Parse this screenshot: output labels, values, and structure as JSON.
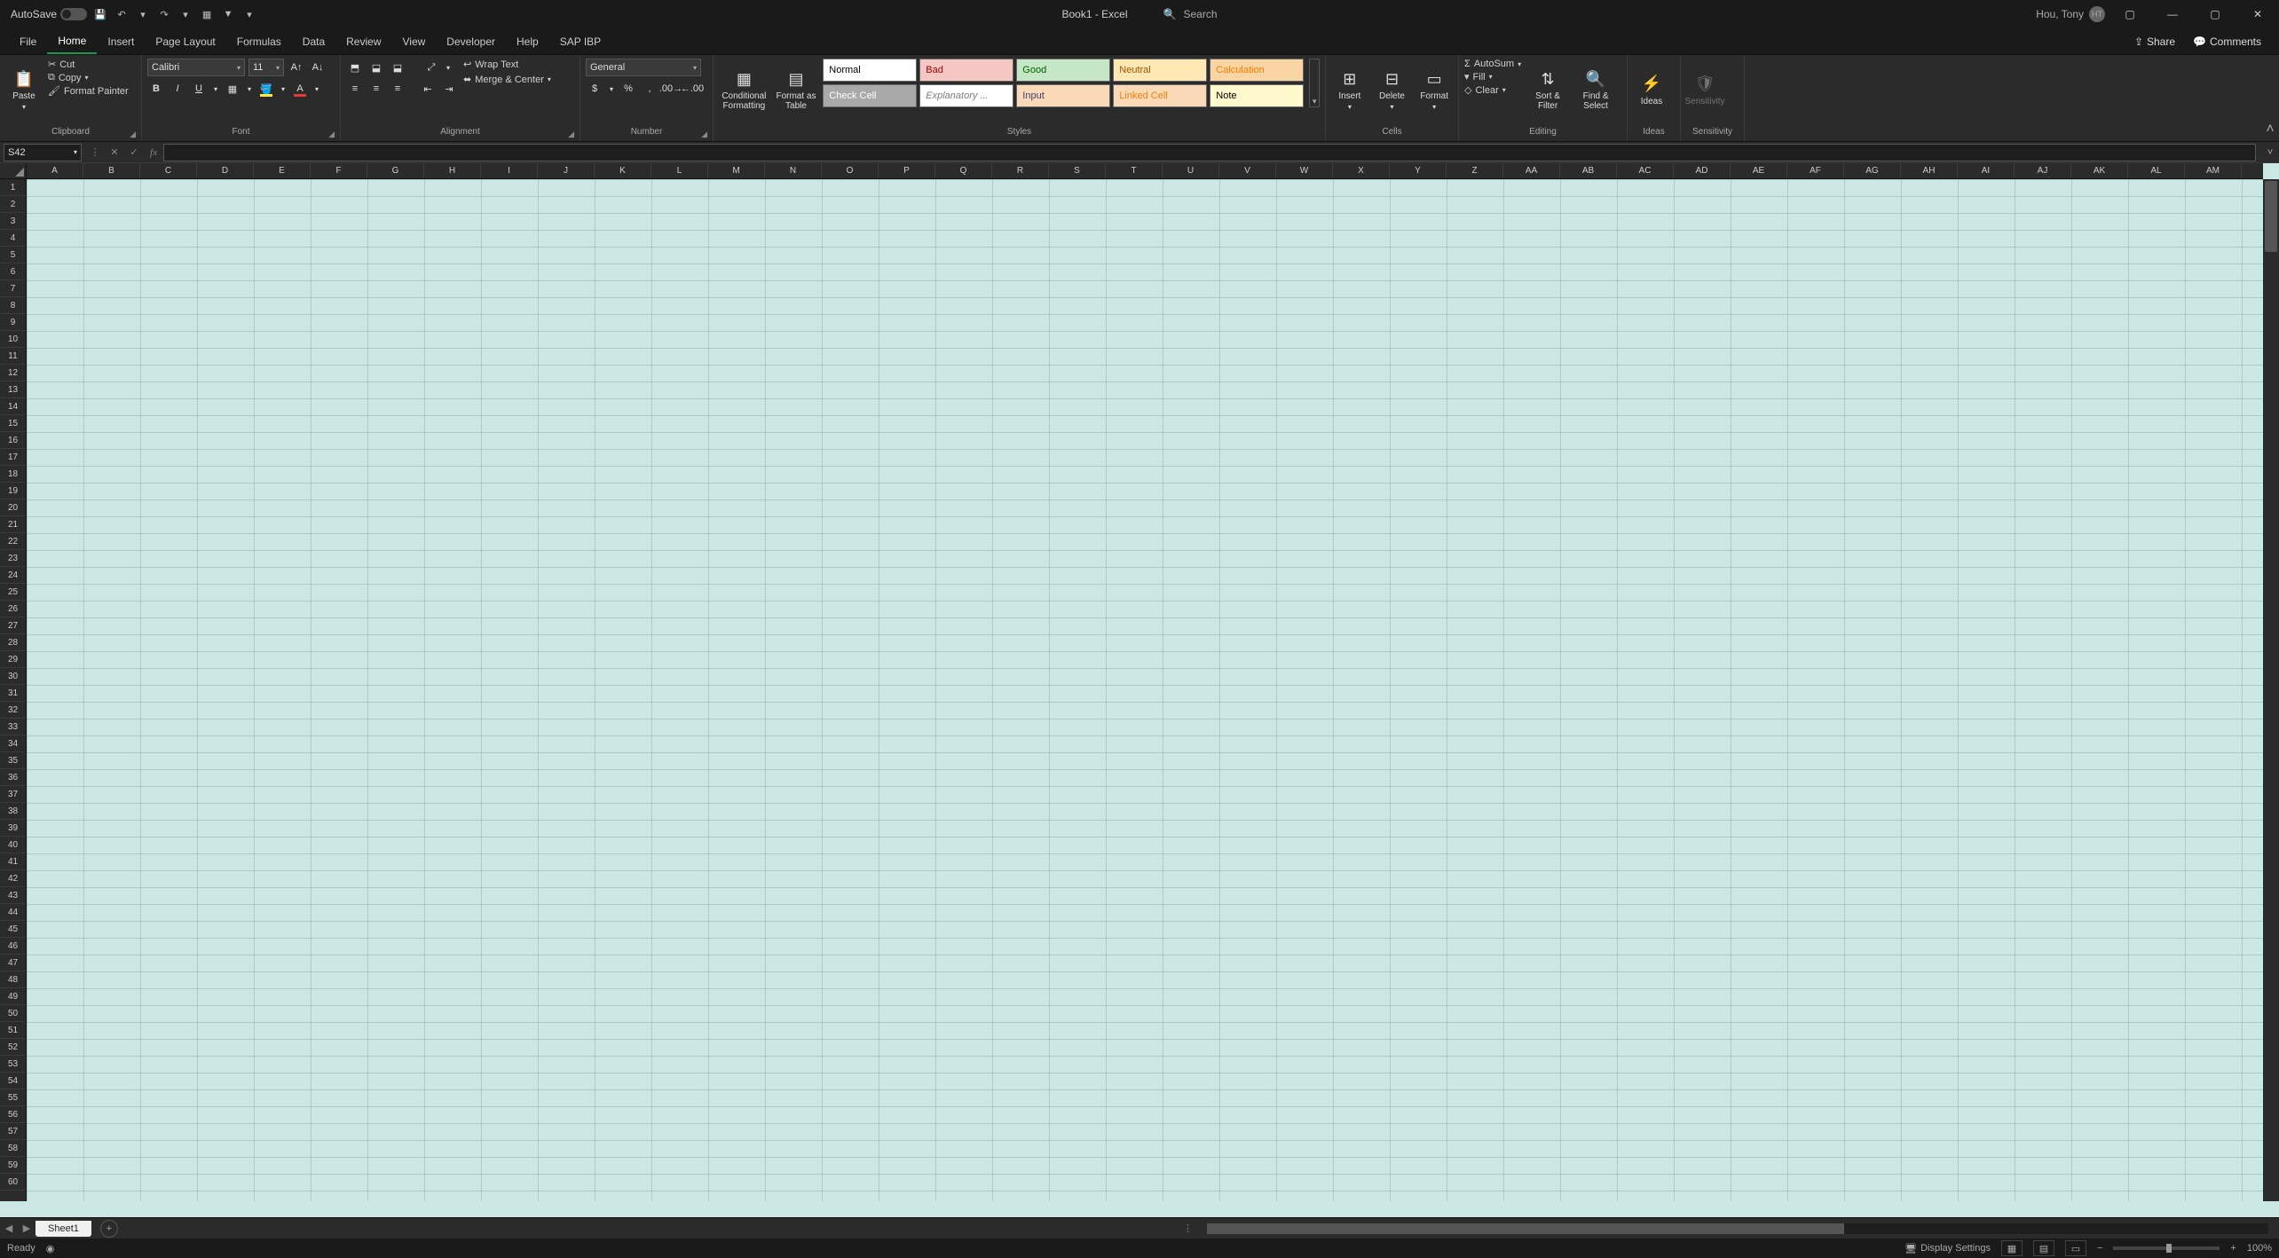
{
  "titlebar": {
    "autosave_label": "AutoSave",
    "doc_title": "Book1 - Excel",
    "search_placeholder": "Search",
    "user_name": "Hou, Tony",
    "user_initials": "HT"
  },
  "tabs": {
    "file": "File",
    "home": "Home",
    "insert": "Insert",
    "page_layout": "Page Layout",
    "formulas": "Formulas",
    "data": "Data",
    "review": "Review",
    "view": "View",
    "developer": "Developer",
    "help": "Help",
    "sap_ibp": "SAP IBP",
    "share": "Share",
    "comments": "Comments"
  },
  "clipboard": {
    "paste": "Paste",
    "cut": "Cut",
    "copy": "Copy",
    "format_painter": "Format Painter",
    "group": "Clipboard"
  },
  "font": {
    "name": "Calibri",
    "size": "11",
    "group": "Font"
  },
  "alignment": {
    "wrap_text": "Wrap Text",
    "merge_center": "Merge & Center",
    "group": "Alignment"
  },
  "number": {
    "format": "General",
    "group": "Number"
  },
  "styles": {
    "conditional": "Conditional Formatting",
    "format_table": "Format as Table",
    "normal": "Normal",
    "bad": "Bad",
    "good": "Good",
    "neutral": "Neutral",
    "calculation": "Calculation",
    "check_cell": "Check Cell",
    "explanatory": "Explanatory ...",
    "input": "Input",
    "linked_cell": "Linked Cell",
    "note": "Note",
    "group": "Styles"
  },
  "cells": {
    "insert": "Insert",
    "delete": "Delete",
    "format": "Format",
    "group": "Cells"
  },
  "editing": {
    "autosum": "AutoSum",
    "fill": "Fill",
    "clear": "Clear",
    "sort_filter": "Sort & Filter",
    "find_select": "Find & Select",
    "group": "Editing"
  },
  "ideas": {
    "label": "Ideas",
    "group": "Ideas"
  },
  "sensitivity": {
    "label": "Sensitivity",
    "group": "Sensitivity"
  },
  "namebox": "S42",
  "columns": [
    "A",
    "B",
    "C",
    "D",
    "E",
    "F",
    "G",
    "H",
    "I",
    "J",
    "K",
    "L",
    "M",
    "N",
    "O",
    "P",
    "Q",
    "R",
    "S",
    "T",
    "U",
    "V",
    "W",
    "X",
    "Y",
    "Z",
    "AA",
    "AB",
    "AC",
    "AD",
    "AE",
    "AF",
    "AG",
    "AH",
    "AI",
    "AJ",
    "AK",
    "AL",
    "AM"
  ],
  "row_count": 60,
  "sheet": {
    "name": "Sheet1"
  },
  "status": {
    "ready": "Ready",
    "display_settings": "Display Settings",
    "zoom": "100%"
  },
  "colors": {
    "cell_bg": "#cce8e4",
    "bad_bg": "#f4c7c3",
    "good_bg": "#c6e7c6",
    "neutral_bg": "#ffe8b3",
    "calc_bg": "#f8d5a3",
    "checkcell_bg": "#a9a9a9",
    "input_bg": "#f9d9b7",
    "linked_bg": "#f9d9b7",
    "note_bg": "#fff8cc"
  }
}
